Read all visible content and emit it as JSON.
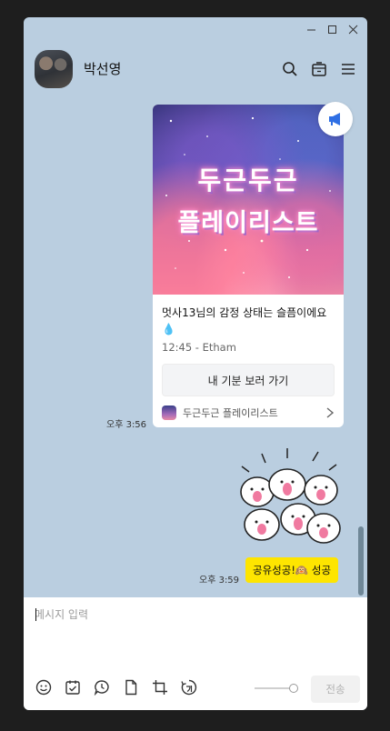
{
  "header": {
    "chat_name": "박선영"
  },
  "card": {
    "image_title_line1": "두근두근",
    "image_title_line2": "플레이리스트",
    "description": "멋사13님의 감정 상태는 슬픔이에요💧",
    "meta": "12:45 - Etham",
    "button_label": "내 기분 보러 가기",
    "source_label": "두근두근 플레이리스트"
  },
  "messages": {
    "card_time": "오후 3:56",
    "sticker_time": "오후 3:59",
    "share_bubble": "공유성공!🙉 성공"
  },
  "composer": {
    "placeholder": "메시지 입력",
    "send_label": "전송"
  },
  "colors": {
    "chat_background": "#bacee0",
    "bubble_yellow": "#fee500",
    "accent_blue": "#2f6fe4"
  },
  "icons": {
    "header": [
      "search-icon",
      "calendar-box-icon",
      "menu-icon"
    ],
    "toolbar": [
      "emoji-icon",
      "calendar-check-icon",
      "speech-bubble-icon",
      "file-icon",
      "crop-icon",
      "translate-icon"
    ]
  }
}
